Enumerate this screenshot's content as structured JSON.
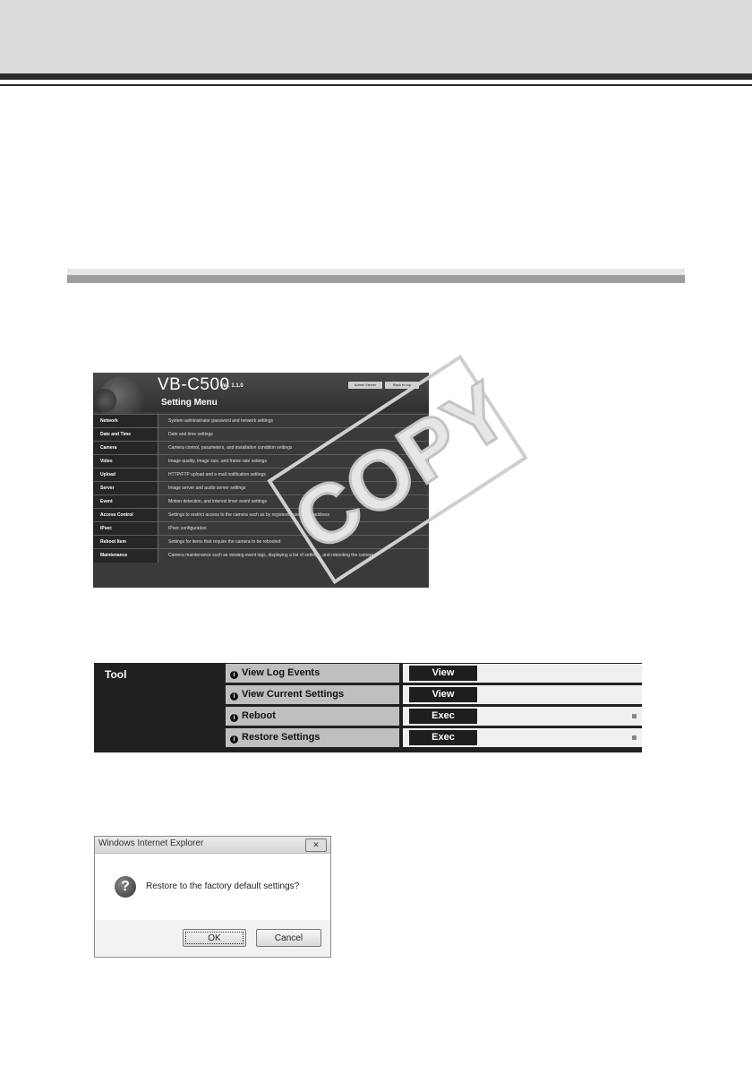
{
  "settings_screen": {
    "model": "VB-C500",
    "version": "Ver. 1.1.0",
    "admin_viewer_button": "Admin Viewer",
    "back_to_top_button": "Back to top",
    "menu_title": "Setting Menu",
    "rows": [
      {
        "name": "Network",
        "desc": "System administrator password and network settings"
      },
      {
        "name": "Date and Time",
        "desc": "Date and time settings"
      },
      {
        "name": "Camera",
        "desc": "Camera control, parameters, and installation condition settings"
      },
      {
        "name": "Video",
        "desc": "Image quality, image size, and frame rate settings"
      },
      {
        "name": "Upload",
        "desc": "HTTP/FTP upload and e-mail notification settings"
      },
      {
        "name": "Server",
        "desc": "Image server and audio server settings"
      },
      {
        "name": "Event",
        "desc": "Motion detection, and interval timer event settings"
      },
      {
        "name": "Access Control",
        "desc": "Settings to restrict access to the camera such as by registered user or IP address"
      },
      {
        "name": "IPsec",
        "desc": "IPsec configuration"
      },
      {
        "name": "Reboot Item",
        "desc": "Settings for items that require the camera to be rebooted"
      },
      {
        "name": "Maintenance",
        "desc": "Camera maintenance such as viewing event logs, displaying a list of settings, and rebooting the camera"
      }
    ]
  },
  "watermark": "COPY",
  "tool_panel": {
    "label": "Tool",
    "rows": [
      {
        "name": "View Log Events",
        "button": "View"
      },
      {
        "name": "View Current Settings",
        "button": "View"
      },
      {
        "name": "Reboot",
        "button": "Exec"
      },
      {
        "name": "Restore Settings",
        "button": "Exec"
      }
    ]
  },
  "dialog": {
    "title": "Windows Internet Explorer",
    "close_glyph": "✕",
    "message": "Restore to the factory default settings?",
    "ok_label": "OK",
    "cancel_label": "Cancel"
  },
  "icons": {
    "info": "i",
    "question": "?"
  },
  "colors": {
    "header_band": "#dcdcdc",
    "rule": "#2b2b2b",
    "section_bar": "#9d9d9d",
    "settings_bg": "#3a3a3a",
    "tool_bg": "#202020"
  }
}
